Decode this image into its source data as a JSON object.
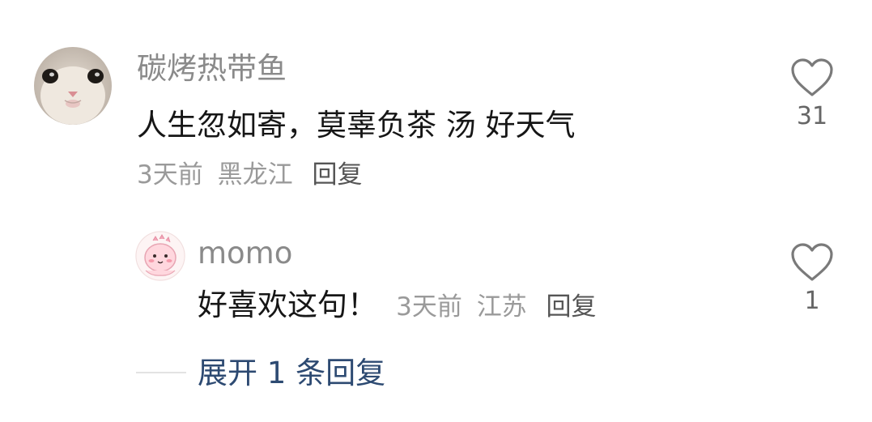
{
  "comment": {
    "username": "碳烤热带鱼",
    "text": "人生忽如寄，莫辜负茶 汤 好天气",
    "time": "3天前",
    "location": "黑龙江",
    "reply_label": "回复",
    "like_count": "31"
  },
  "reply": {
    "username": "momo",
    "text": "好喜欢这句！",
    "time": "3天前",
    "location": "江苏",
    "reply_label": "回复",
    "like_count": "1"
  },
  "expand": {
    "label": "展开 1 条回复"
  },
  "colors": {
    "text_primary": "#161616",
    "text_secondary": "#8a8a8a",
    "link_blue": "#2d4a72",
    "icon_gray": "#7a7a7a"
  },
  "icons": {
    "like": "heart-outline-icon"
  }
}
